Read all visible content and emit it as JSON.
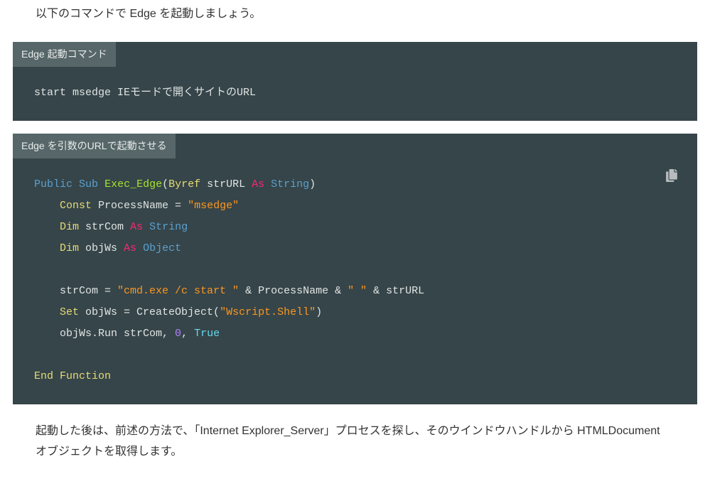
{
  "intro_text": "以下のコマンドで Edge を起動しましょう。",
  "block1": {
    "title": "Edge 起動コマンド",
    "content": "start msedge IEモードで開くサイトのURL"
  },
  "block2": {
    "title": "Edge を引数のURLで起動させる",
    "tokens": {
      "public": "Public",
      "sub": "Sub",
      "fn_name": "Exec_Edge",
      "lparen": "(",
      "byref": "Byref",
      "p_name": " strURL ",
      "as": "As",
      "string_t": "String",
      "rparen": ")",
      "const": "Const",
      "pn_name": " ProcessName = ",
      "pn_val": "\"msedge\"",
      "dim": "Dim",
      "strcom_name": " strCom ",
      "object_t": "Object",
      "objws_name": " objWs ",
      "assign1_lhs": "strCom = ",
      "assign1_str1": "\"cmd.exe /c start \"",
      "amp": " & ",
      "pn_ref": "ProcessName",
      "assign1_str2": "\" \"",
      "strurl_ref": "strURL",
      "set": "Set",
      "objws_assign": " objWs = CreateObject(",
      "shell_str": "\"Wscript.Shell\"",
      "close_paren": ")",
      "run_line_a": "objWs.Run strCom, ",
      "zero": "0",
      "comma_sp": ", ",
      "true": "True",
      "end": "End",
      "function": "Function"
    }
  },
  "outro_text": "起動した後は、前述の方法で、「Internet Explorer_Server」プロセスを探し、そのウインドウハンドルから HTMLDocument オブジェクトを取得します。"
}
